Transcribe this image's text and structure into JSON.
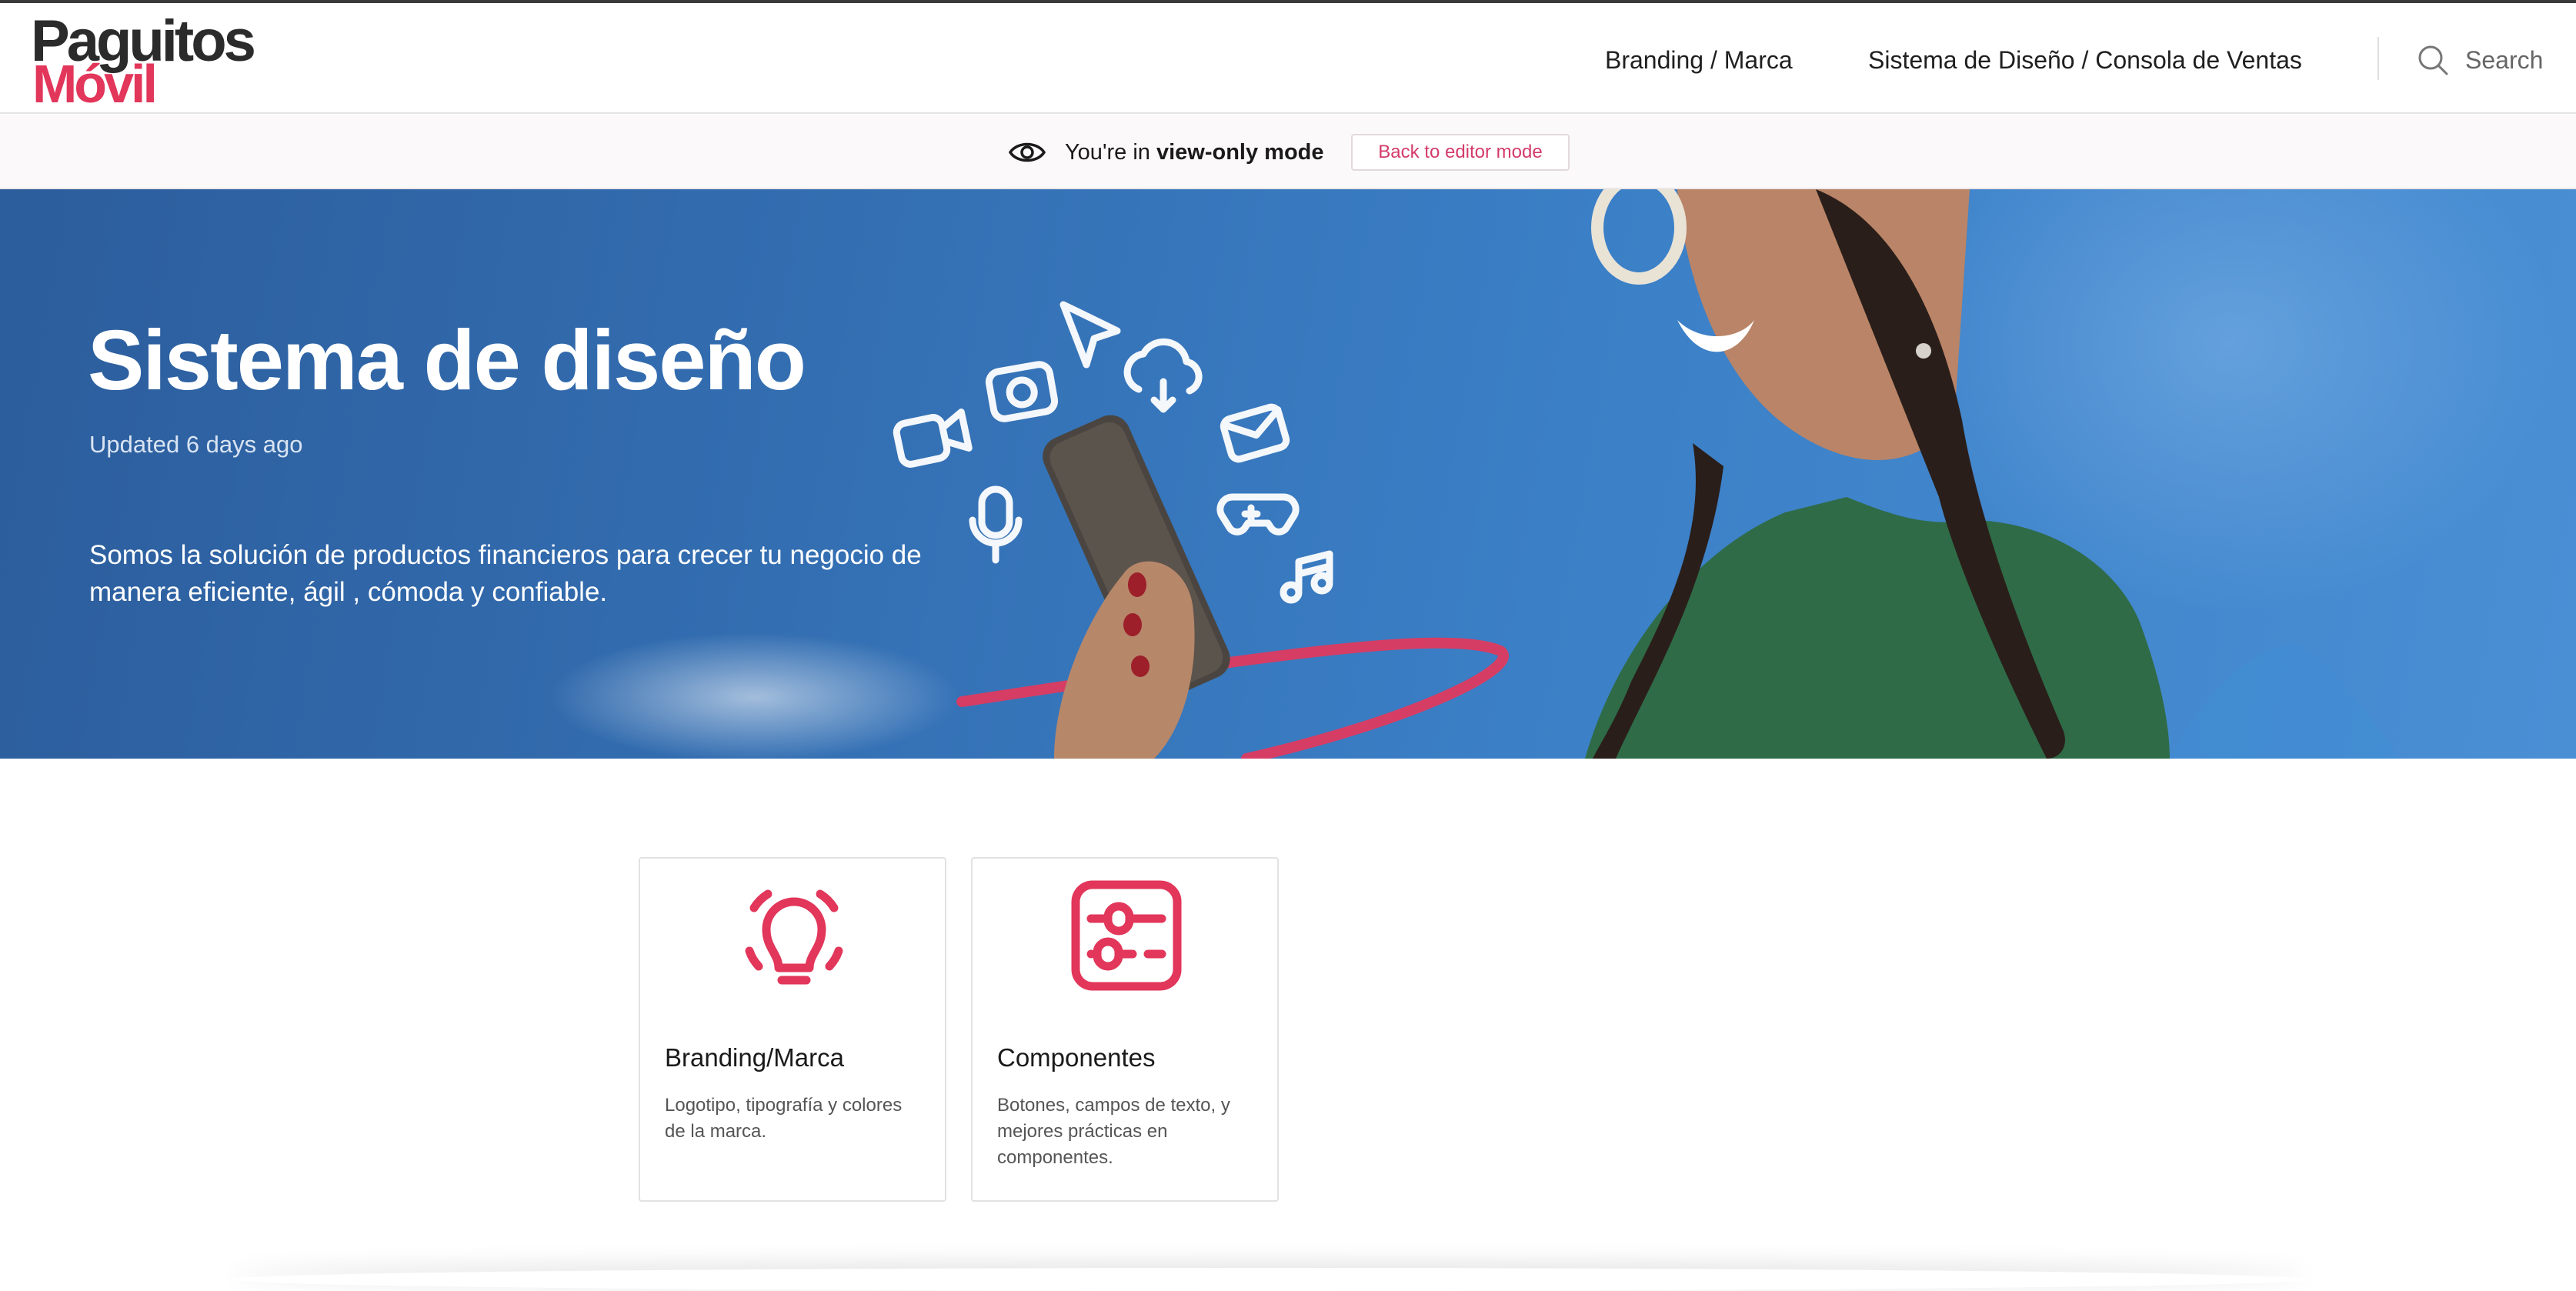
{
  "brand": {
    "line1": "Paguitos",
    "line2": "Móvil",
    "accent": "#e2365a"
  },
  "nav": {
    "items": [
      {
        "label": "Branding / Marca"
      },
      {
        "label": "Sistema de Diseño / Consola de Ventas"
      }
    ],
    "search_label": "Search"
  },
  "view_mode": {
    "prefix": "You're in ",
    "bold": "view-only mode",
    "back_button": "Back to editor mode"
  },
  "hero": {
    "title": "Sistema de diseño",
    "updated": "Updated 6 days ago",
    "description": "Somos la solución de productos financieros para crecer tu negocio de manera eficiente, ágil , cómoda y confiable."
  },
  "cards": [
    {
      "title": "Branding/Marca",
      "description": "Logotipo, tipografía y colores de la marca.",
      "icon": "lightbulb-icon"
    },
    {
      "title": "Componentes",
      "description": "Botones, campos de texto, y mejores prácticas en componentes.",
      "icon": "sliders-icon"
    }
  ]
}
